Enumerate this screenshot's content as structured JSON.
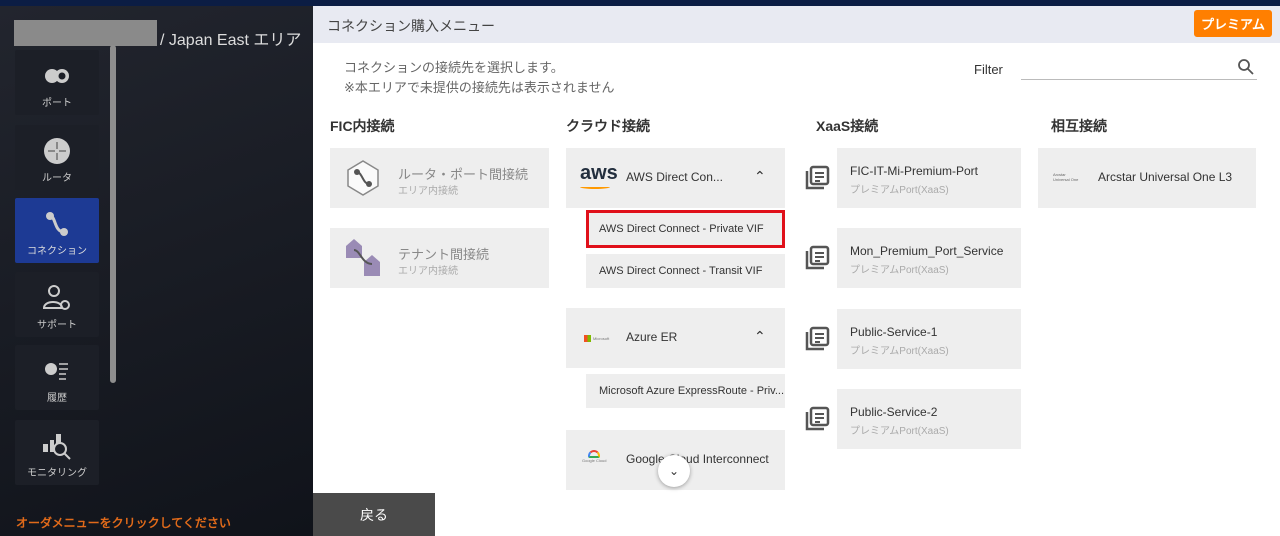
{
  "breadcrumb": {
    "area": "/ Japan East エリア"
  },
  "sidebar": {
    "items": [
      {
        "label": "ポート",
        "icon": "port-icon"
      },
      {
        "label": "ルータ",
        "icon": "router-icon"
      },
      {
        "label": "コネクション",
        "icon": "connection-icon",
        "active": true
      },
      {
        "label": "サポート",
        "icon": "support-icon"
      },
      {
        "label": "履歴",
        "icon": "history-icon"
      },
      {
        "label": "モニタリング",
        "icon": "monitoring-icon"
      }
    ],
    "order_hint": "オーダメニューをクリックしてください"
  },
  "modal": {
    "title": "コネクション購入メニュー",
    "premium_label": "プレミアム",
    "desc1": "コネクションの接続先を選択します。",
    "desc2": "※本エリアで未提供の接続先は表示されません",
    "filter_label": "Filter",
    "filter_value": "",
    "back_label": "戻る",
    "columns": [
      {
        "header": "FIC内接続",
        "cards": [
          {
            "title": "ルータ・ポート間接続",
            "sub": "エリア内接続"
          },
          {
            "title": "テナント間接続",
            "sub": "エリア内接続"
          }
        ]
      },
      {
        "header": "クラウド接続",
        "groups": [
          {
            "title": "AWS Direct Con...",
            "logo": "aws",
            "expanded": true,
            "items": [
              "AWS Direct Connect - Private VIF",
              "AWS Direct Connect - Transit VIF"
            ],
            "selected": 0
          },
          {
            "title": "Azure ER",
            "logo": "Microsoft Azure",
            "expanded": true,
            "items": [
              "Microsoft Azure ExpressRoute - Priv..."
            ]
          },
          {
            "title": "Google Cloud Interconnect",
            "logo": "Google Cloud",
            "expanded": false
          }
        ]
      },
      {
        "header": "XaaS接続",
        "cards": [
          {
            "title": "FIC-IT-Mi-Premium-Port",
            "sub": "プレミアムPort(XaaS)"
          },
          {
            "title": "Mon_Premium_Port_Service",
            "sub": "プレミアムPort(XaaS)"
          },
          {
            "title": "Public-Service-1",
            "sub": "プレミアムPort(XaaS)"
          },
          {
            "title": "Public-Service-2",
            "sub": "プレミアムPort(XaaS)"
          }
        ]
      },
      {
        "header": "相互接続",
        "cards": [
          {
            "title": "Arcstar Universal One L3",
            "logo": "Arcstar Universal One"
          }
        ]
      }
    ]
  },
  "colors": {
    "accent": "#ff7f00",
    "active_nav": "#1d3a94",
    "selection": "#e0101a"
  }
}
